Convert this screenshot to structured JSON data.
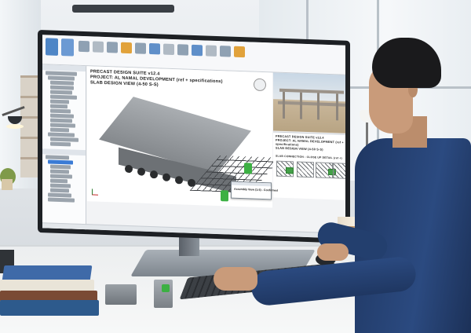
{
  "screen": {
    "main_caption": {
      "line1": "PRECAST DESIGN SUITE v12.4",
      "line2": "PROJECT: AL NAMAL DEVELOPMENT (ref + specifications)",
      "line3": "SLAB DESIGN VIEW (4-50 S-S)"
    },
    "sheet_caption": {
      "line1": "PRECAST DESIGN SUITE v12.4",
      "line2": "PROJECT: AL NAMAL DEVELOPMENT (ref + specifications)",
      "line3": "SLAB DESIGN VIEW (4-50 S-S)"
    },
    "connection_caption": "SLAB CONNECTION - CLOSE UP DETAIL (ref +)",
    "dialog_text": "Assembly View (1:5) - Confirmed"
  },
  "colors": {
    "accent_blue": "#3a7bd5",
    "connector_green": "#3cb043",
    "shirt_navy": "#1f3762"
  },
  "icons": [
    "ribbon-tool-icon",
    "viewcube-icon",
    "axis-icon"
  ]
}
